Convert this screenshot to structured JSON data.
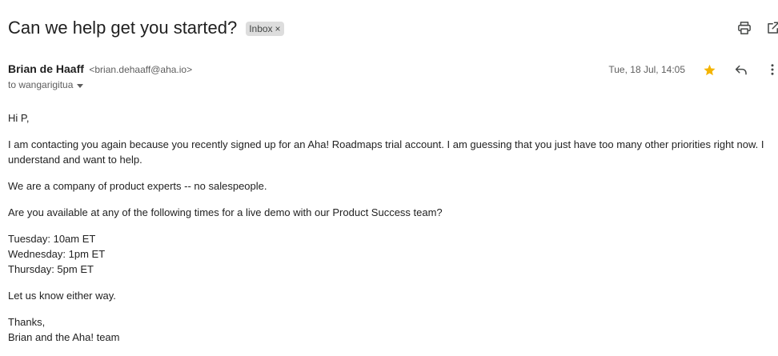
{
  "email": {
    "subject": "Can we help get you started?",
    "label": "Inbox",
    "label_remove": "×",
    "sender_name": "Brian de Haaff",
    "sender_email": "<brian.dehaaff@aha.io>",
    "recipient": "to wangarigitua",
    "date": "Tue, 18 Jul, 14:05",
    "starred": true,
    "colors": {
      "star": "#f4b400",
      "label_bg": "#dddddd"
    },
    "icons": {
      "print": "print-icon",
      "open_new_window": "open-in-new-window-icon",
      "star": "star-icon",
      "reply": "reply-icon",
      "more": "more-vertical-icon",
      "recipient_details": "caret-down-icon"
    },
    "body": {
      "greeting": "Hi P,",
      "para1": "I am contacting you again because you recently signed up for an Aha! Roadmaps trial account. I am guessing that you just have too many other priorities right now. I understand and want to help.",
      "para2": "We are a company of product experts -- no salespeople.",
      "para3": "Are you available at any of the following times for a live demo with our Product Success team?",
      "times": [
        "Tuesday: 10am ET",
        "Wednesday: 1pm ET",
        "Thursday: 5pm ET"
      ],
      "para4": "Let us know either way.",
      "signoff": [
        "Thanks,",
        "Brian and the Aha! team"
      ]
    }
  }
}
